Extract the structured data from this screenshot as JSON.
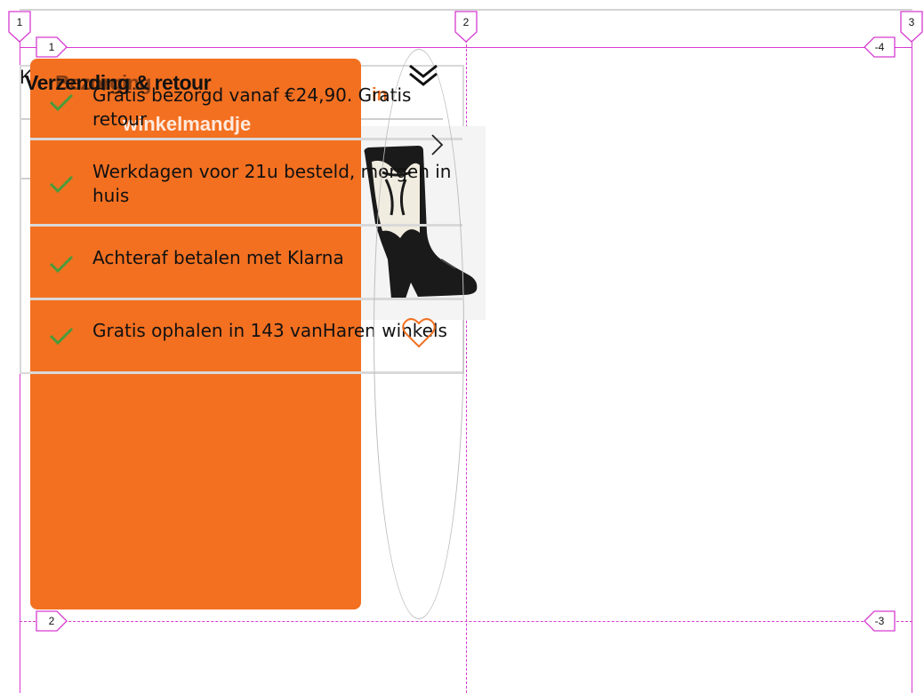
{
  "page": {
    "heading": "Verzending & retour",
    "heading_ghost": "Bezorging",
    "panel_ghost_title": "winkelmandje",
    "under_letter": "K",
    "orange_hint": "in"
  },
  "usps": [
    {
      "text": "Gratis bezorgd vanaf €24,90. Gratis retour",
      "icon": "check-icon"
    },
    {
      "text": "Werkdagen voor 21u besteld, morgen in huis",
      "icon": "check-icon"
    },
    {
      "text": "Achteraf betalen met Klarna",
      "icon": "check-icon"
    },
    {
      "text": "Gratis ophalen in 143 vanHaren winkels",
      "icon": "check-icon"
    }
  ],
  "grid_overlay": {
    "columns": [
      "1",
      "2",
      "3"
    ],
    "rows_left": [
      "1",
      "2"
    ],
    "rows_right": [
      "-4",
      "-3"
    ]
  },
  "icons": {
    "collapse": "double-chevron-down-icon",
    "next": "chevron-right-icon",
    "wishlist": "heart-icon",
    "product": "cowboy-boot-image"
  },
  "colors": {
    "brand_orange": "#f37021",
    "check_green": "#4a9b3a",
    "grid_magenta": "#d63ad0"
  }
}
